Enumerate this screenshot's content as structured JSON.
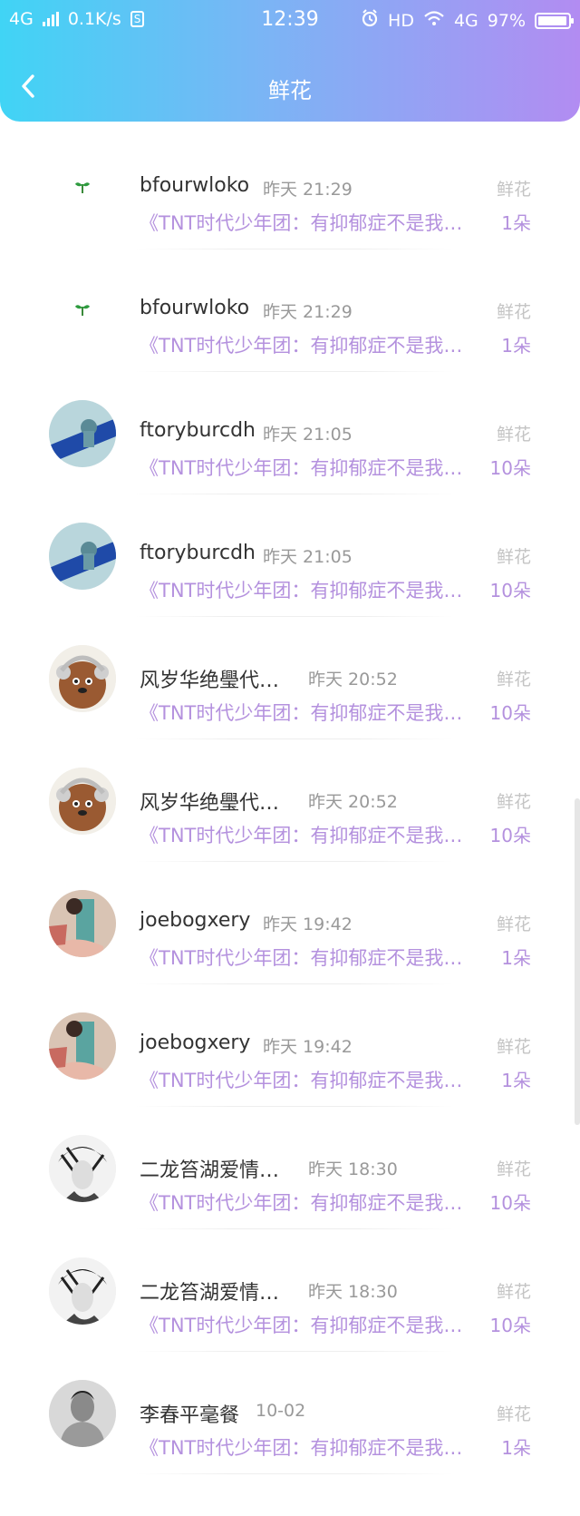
{
  "status_bar": {
    "network": "4G",
    "speed": "0.1K/s",
    "time": "12:39",
    "hd": "HD",
    "network2": "4G",
    "battery": "97%",
    "battery_level": 0.97
  },
  "header": {
    "title": "鲜花"
  },
  "records": [
    {
      "name": "bfourwloko",
      "time": "昨天 21:29",
      "category": "鲜花",
      "article": "《TNT时代少年团：有抑郁症不是我…",
      "count": "1朵",
      "avatar": "sprout"
    },
    {
      "name": "bfourwloko",
      "time": "昨天 21:29",
      "category": "鲜花",
      "article": "《TNT时代少年团：有抑郁症不是我…",
      "count": "1朵",
      "avatar": "sprout"
    },
    {
      "name": "ftoryburcdh",
      "time": "昨天 21:05",
      "category": "鲜花",
      "article": "《TNT时代少年团：有抑郁症不是我…",
      "count": "10朵",
      "avatar": "blue"
    },
    {
      "name": "ftoryburcdh",
      "time": "昨天 21:05",
      "category": "鲜花",
      "article": "《TNT时代少年团：有抑郁症不是我…",
      "count": "10朵",
      "avatar": "blue"
    },
    {
      "name": "风岁华绝璺代…",
      "time": "昨天 20:52",
      "category": "鲜花",
      "article": "《TNT时代少年团：有抑郁症不是我…",
      "count": "10朵",
      "avatar": "bear"
    },
    {
      "name": "风岁华绝璺代…",
      "time": "昨天 20:52",
      "category": "鲜花",
      "article": "《TNT时代少年团：有抑郁症不是我…",
      "count": "10朵",
      "avatar": "bear"
    },
    {
      "name": "joebogxery",
      "time": "昨天 19:42",
      "category": "鲜花",
      "article": "《TNT时代少年团：有抑郁症不是我…",
      "count": "1朵",
      "avatar": "girl"
    },
    {
      "name": "joebogxery",
      "time": "昨天 19:42",
      "category": "鲜花",
      "article": "《TNT时代少年团：有抑郁症不是我…",
      "count": "1朵",
      "avatar": "girl"
    },
    {
      "name": "二龙笞湖爱情…",
      "time": "昨天 18:30",
      "category": "鲜花",
      "article": "《TNT时代少年团：有抑郁症不是我…",
      "count": "10朵",
      "avatar": "sketch"
    },
    {
      "name": "二龙笞湖爱情…",
      "time": "昨天 18:30",
      "category": "鲜花",
      "article": "《TNT时代少年团：有抑郁症不是我…",
      "count": "10朵",
      "avatar": "sketch"
    },
    {
      "name": "李春平毫餐",
      "time": "10-02",
      "category": "鲜花",
      "article": "《TNT时代少年团：有抑郁症不是我…",
      "count": "1朵",
      "avatar": "man"
    }
  ]
}
